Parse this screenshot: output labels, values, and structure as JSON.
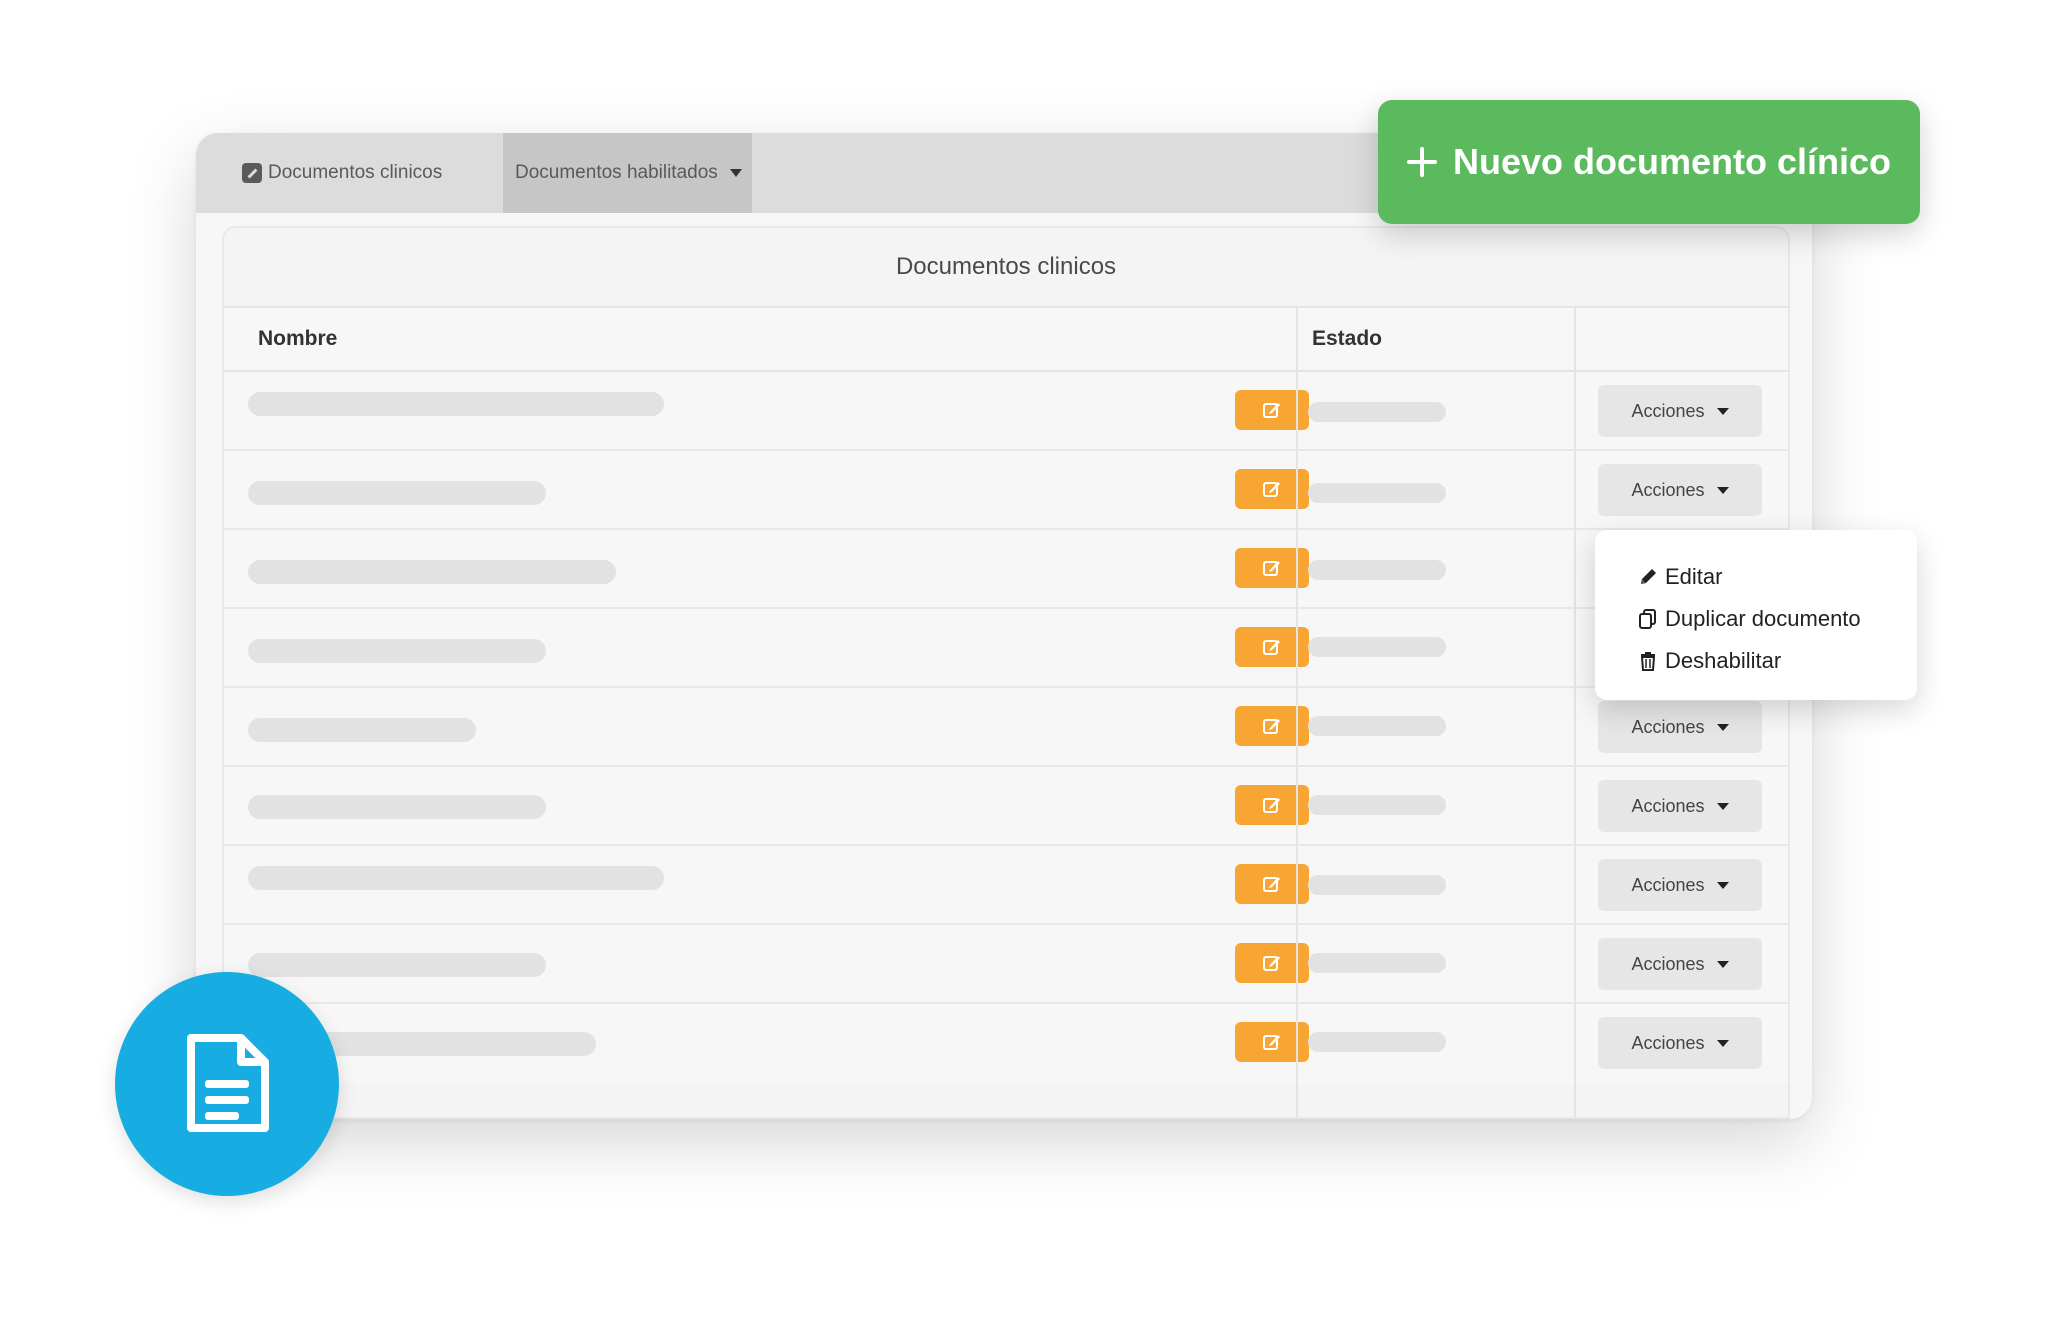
{
  "tabs": {
    "tab1_label": "Documentos clinicos",
    "tab2_label": "Documentos habilitados"
  },
  "new_button": {
    "label": "Nuevo documento clínico"
  },
  "table": {
    "title": "Documentos clinicos",
    "columns": {
      "name": "Nombre",
      "state": "Estado",
      "actions": ""
    },
    "rows": [
      {
        "actions_label": "Acciones"
      },
      {
        "actions_label": "Acciones"
      },
      {
        "actions_label": "Acciones"
      },
      {
        "actions_label": "Acciones"
      },
      {
        "actions_label": "Acciones"
      },
      {
        "actions_label": "Acciones"
      },
      {
        "actions_label": "Acciones"
      },
      {
        "actions_label": "Acciones"
      },
      {
        "actions_label": "Acciones"
      }
    ]
  },
  "actions_menu": {
    "items": [
      "Editar",
      "Duplicar documento",
      "Deshabilitar"
    ]
  },
  "icons": {
    "tab1": "edit-square-icon",
    "tab2_caret": "caret-down-icon",
    "new_button": "plus-icon",
    "row_edit": "edit-icon",
    "menu_edit": "pencil-icon",
    "menu_duplicate": "copy-icon",
    "menu_disable": "trash-icon",
    "badge": "document-icon"
  },
  "colors": {
    "primary_green": "#5cba5e",
    "edit_orange": "#f7a533",
    "badge_blue": "#17ade3",
    "tabbar_gray": "#dcdcdc"
  }
}
